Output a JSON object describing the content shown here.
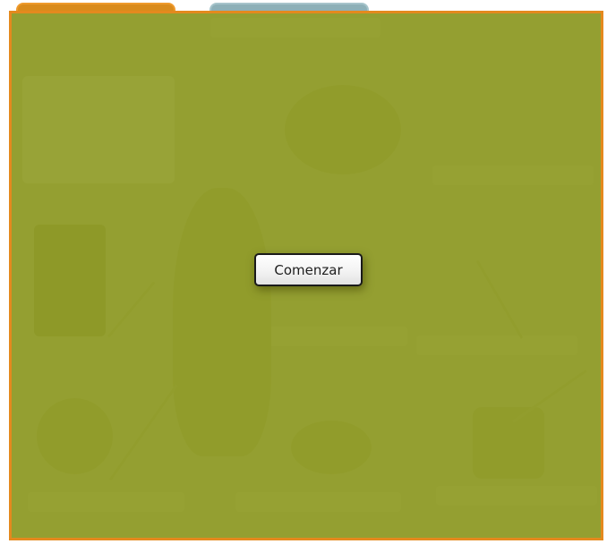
{
  "overlay": {
    "start_button_label": "Comenzar"
  },
  "colors": {
    "frame_border": "#e4891e",
    "overlay": "#8a9623",
    "tab_left": "#d98b1c",
    "tab_right": "#8db0b8"
  },
  "icons": [
    "bird-character-illustration",
    "boy-character-illustration",
    "phone-illustration",
    "tree-illustration",
    "yarn-ball-illustration",
    "magic-hat-illustration"
  ]
}
